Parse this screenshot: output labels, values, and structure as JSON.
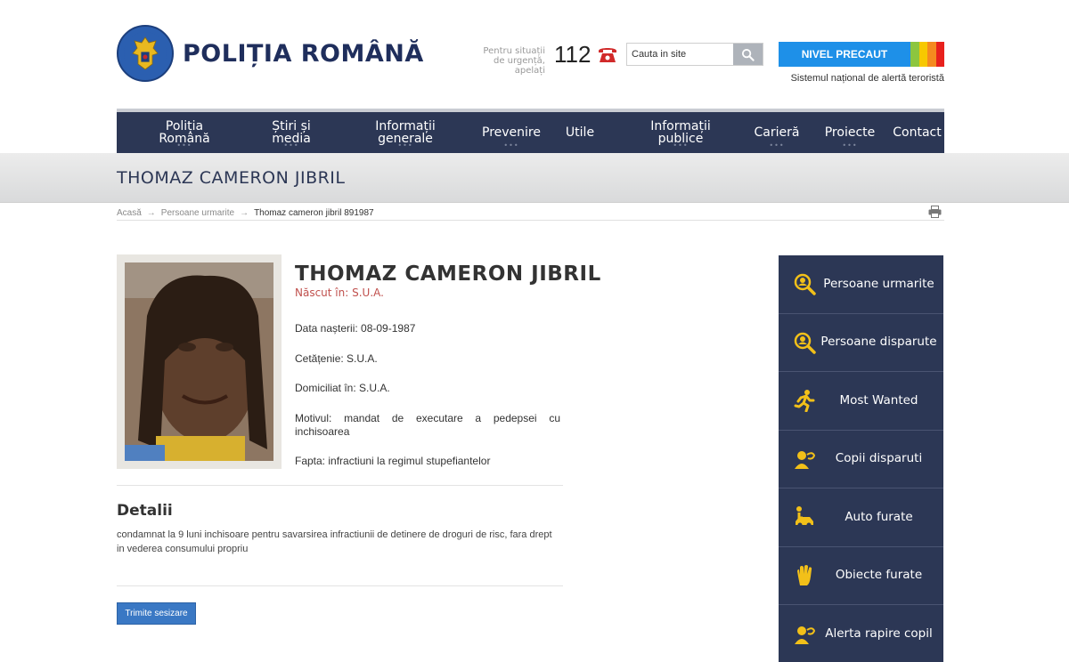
{
  "header": {
    "logo_text": "POLIȚIA ROMÂNĂ",
    "emergency_text": "Pentru situații de urgență, apelați",
    "emergency_number": "112",
    "search": {
      "placeholder": "Cauta in site"
    },
    "alert": {
      "label": "NIVEL PRECAUT",
      "caption": "Sistemul național de alertă teroristă",
      "colors": [
        "#1e90e8",
        "#8cc63f",
        "#f7c800",
        "#f58a1f",
        "#e8211d"
      ]
    }
  },
  "nav": {
    "items": [
      {
        "label": "Poliția Română",
        "has_menu": true
      },
      {
        "label": "Știri și media",
        "has_menu": true
      },
      {
        "label": "Informații generale",
        "has_menu": true
      },
      {
        "label": "Prevenire",
        "has_menu": true
      },
      {
        "label": "Utile",
        "has_menu": false
      },
      {
        "label": "Informații publice",
        "has_menu": true
      },
      {
        "label": "Carieră",
        "has_menu": true
      },
      {
        "label": "Proiecte",
        "has_menu": true
      },
      {
        "label": "Contact",
        "has_menu": false
      }
    ]
  },
  "page": {
    "title": "THOMAZ CAMERON JIBRIL"
  },
  "breadcrumb": {
    "items": [
      "Acasă",
      "Persoane urmarite"
    ],
    "current": "Thomaz cameron jibril 891987"
  },
  "profile": {
    "name": "THOMAZ CAMERON JIBRIL",
    "born": "Născut în: S.U.A.",
    "birth_date": "Data nașterii: 08-09-1987",
    "citizenship": "Cetățenie: S.U.A.",
    "residence": "Domiciliat în: S.U.A.",
    "reason": "Motivul: mandat de executare a pedepsei cu inchisoarea",
    "offense": "Fapta: infractiuni la regimul stupefiantelor"
  },
  "details": {
    "title": "Detalii",
    "text": "condamnat la 9 luni inchisoare pentru savarsirea infractiunii de detinere de droguri de risc, fara drept in vederea consumului propriu"
  },
  "actions": {
    "submit_label": "Trimite sesizare"
  },
  "sidebar": {
    "items": [
      {
        "label": "Persoane urmarite",
        "icon": "person-search-icon"
      },
      {
        "label": "Persoane disparute",
        "icon": "person-search-icon"
      },
      {
        "label": "Most Wanted",
        "icon": "running-man-icon"
      },
      {
        "label": "Copii disparuti",
        "icon": "child-icon"
      },
      {
        "label": "Auto furate",
        "icon": "car-icon"
      },
      {
        "label": "Obiecte furate",
        "icon": "hand-icon"
      },
      {
        "label": "Alerta rapire copil",
        "icon": "child-icon"
      }
    ]
  },
  "colors": {
    "nav_bg": "#2c3755",
    "accent_red": "#c0504d",
    "icon_yellow": "#f2c019",
    "button_blue": "#3a78c4"
  }
}
